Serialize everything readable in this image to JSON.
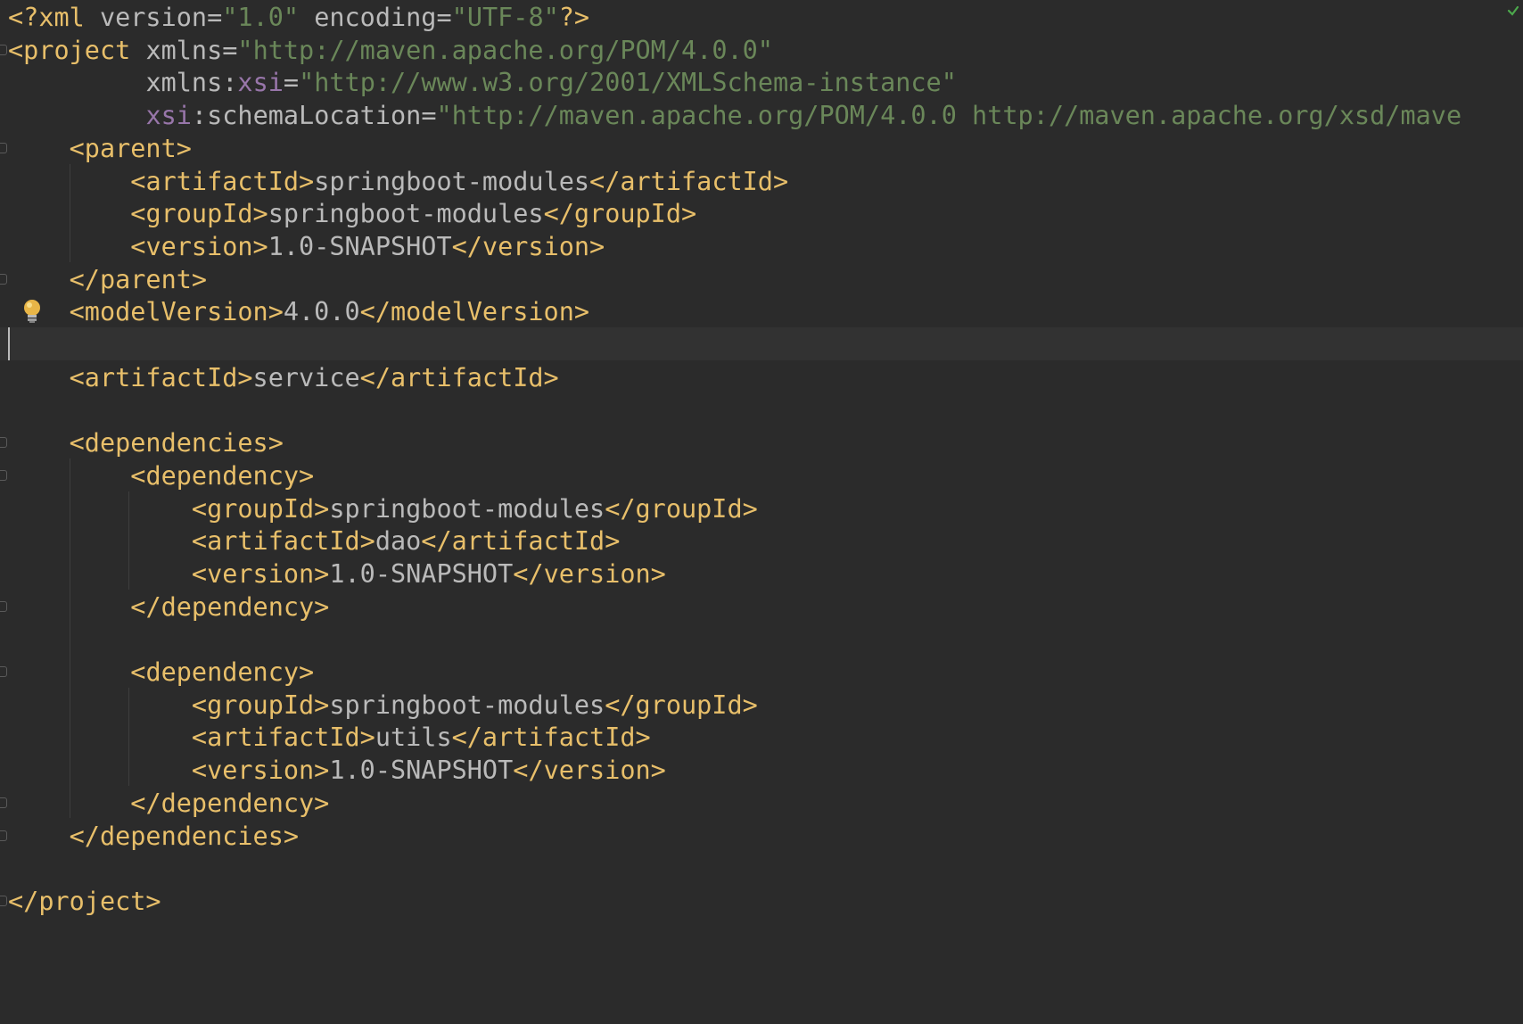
{
  "editor": {
    "language": "xml",
    "colors": {
      "background": "#2b2b2b",
      "tag": "#e8bf6a",
      "attribute": "#bababa",
      "namespace": "#9876aa",
      "string": "#6a8759",
      "text": "#bababa"
    },
    "lines": [
      {
        "indent": "",
        "tokens": [
          {
            "t": "tag",
            "s": "<?xml "
          },
          {
            "t": "attr",
            "s": "version"
          },
          {
            "t": "punc",
            "s": "="
          },
          {
            "t": "val",
            "s": "\"1.0\""
          },
          {
            "t": "punc",
            "s": " "
          },
          {
            "t": "attr",
            "s": "encoding"
          },
          {
            "t": "punc",
            "s": "="
          },
          {
            "t": "val",
            "s": "\"UTF-8\""
          },
          {
            "t": "tag",
            "s": "?>"
          }
        ]
      },
      {
        "indent": "",
        "tokens": [
          {
            "t": "tag",
            "s": "<project "
          },
          {
            "t": "attr",
            "s": "xmlns"
          },
          {
            "t": "punc",
            "s": "="
          },
          {
            "t": "val",
            "s": "\"http://maven.apache.org/POM/4.0.0\""
          }
        ]
      },
      {
        "indent": "         ",
        "tokens": [
          {
            "t": "attr",
            "s": "xmlns"
          },
          {
            "t": "punc",
            "s": ":"
          },
          {
            "t": "ns",
            "s": "xsi"
          },
          {
            "t": "punc",
            "s": "="
          },
          {
            "t": "val",
            "s": "\"http://www.w3.org/2001/XMLSchema-instance\""
          }
        ]
      },
      {
        "indent": "         ",
        "tokens": [
          {
            "t": "ns",
            "s": "xsi"
          },
          {
            "t": "punc",
            "s": ":"
          },
          {
            "t": "attr",
            "s": "schemaLocation"
          },
          {
            "t": "punc",
            "s": "="
          },
          {
            "t": "val",
            "s": "\"http://maven.apache.org/POM/4.0.0 http://maven.apache.org/xsd/mave"
          }
        ]
      },
      {
        "indent": "    ",
        "tokens": [
          {
            "t": "tag",
            "s": "<parent>"
          }
        ]
      },
      {
        "indent": "        ",
        "tokens": [
          {
            "t": "tag",
            "s": "<artifactId>"
          },
          {
            "t": "text",
            "s": "springboot-modules"
          },
          {
            "t": "tag",
            "s": "</artifactId>"
          }
        ]
      },
      {
        "indent": "        ",
        "tokens": [
          {
            "t": "tag",
            "s": "<groupId>"
          },
          {
            "t": "text",
            "s": "springboot-modules"
          },
          {
            "t": "tag",
            "s": "</groupId>"
          }
        ]
      },
      {
        "indent": "        ",
        "tokens": [
          {
            "t": "tag",
            "s": "<version>"
          },
          {
            "t": "text",
            "s": "1.0-SNAPSHOT"
          },
          {
            "t": "tag",
            "s": "</version>"
          }
        ]
      },
      {
        "indent": "    ",
        "tokens": [
          {
            "t": "tag",
            "s": "</parent>"
          }
        ]
      },
      {
        "indent": "    ",
        "tokens": [
          {
            "t": "tag",
            "s": "<modelVersion>"
          },
          {
            "t": "text",
            "s": "4.0.0"
          },
          {
            "t": "tag",
            "s": "</modelVersion>"
          }
        ]
      },
      {
        "indent": "",
        "tokens": []
      },
      {
        "indent": "    ",
        "tokens": [
          {
            "t": "tag",
            "s": "<artifactId>"
          },
          {
            "t": "text",
            "s": "service"
          },
          {
            "t": "tag",
            "s": "</artifactId>"
          }
        ]
      },
      {
        "indent": "",
        "tokens": []
      },
      {
        "indent": "    ",
        "tokens": [
          {
            "t": "tag",
            "s": "<dependencies>"
          }
        ]
      },
      {
        "indent": "        ",
        "tokens": [
          {
            "t": "tag",
            "s": "<dependency>"
          }
        ]
      },
      {
        "indent": "            ",
        "tokens": [
          {
            "t": "tag",
            "s": "<groupId>"
          },
          {
            "t": "text",
            "s": "springboot-modules"
          },
          {
            "t": "tag",
            "s": "</groupId>"
          }
        ]
      },
      {
        "indent": "            ",
        "tokens": [
          {
            "t": "tag",
            "s": "<artifactId>"
          },
          {
            "t": "text",
            "s": "dao"
          },
          {
            "t": "tag",
            "s": "</artifactId>"
          }
        ]
      },
      {
        "indent": "            ",
        "tokens": [
          {
            "t": "tag",
            "s": "<version>"
          },
          {
            "t": "text",
            "s": "1.0-SNAPSHOT"
          },
          {
            "t": "tag",
            "s": "</version>"
          }
        ]
      },
      {
        "indent": "        ",
        "tokens": [
          {
            "t": "tag",
            "s": "</dependency>"
          }
        ]
      },
      {
        "indent": "",
        "tokens": []
      },
      {
        "indent": "        ",
        "tokens": [
          {
            "t": "tag",
            "s": "<dependency>"
          }
        ]
      },
      {
        "indent": "            ",
        "tokens": [
          {
            "t": "tag",
            "s": "<groupId>"
          },
          {
            "t": "text",
            "s": "springboot-modules"
          },
          {
            "t": "tag",
            "s": "</groupId>"
          }
        ]
      },
      {
        "indent": "            ",
        "tokens": [
          {
            "t": "tag",
            "s": "<artifactId>"
          },
          {
            "t": "text",
            "s": "utils"
          },
          {
            "t": "tag",
            "s": "</artifactId>"
          }
        ]
      },
      {
        "indent": "            ",
        "tokens": [
          {
            "t": "tag",
            "s": "<version>"
          },
          {
            "t": "text",
            "s": "1.0-SNAPSHOT"
          },
          {
            "t": "tag",
            "s": "</version>"
          }
        ]
      },
      {
        "indent": "        ",
        "tokens": [
          {
            "t": "tag",
            "s": "</dependency>"
          }
        ]
      },
      {
        "indent": "    ",
        "tokens": [
          {
            "t": "tag",
            "s": "</dependencies>"
          }
        ]
      },
      {
        "indent": "",
        "tokens": []
      },
      {
        "indent": "",
        "tokens": [
          {
            "t": "tag",
            "s": "</project>"
          }
        ]
      }
    ],
    "caret_line": 11,
    "intention_bulb_line": 10,
    "folded_lines": [
      2,
      5,
      9,
      14,
      15,
      19,
      21,
      25,
      26,
      28
    ],
    "icons": [
      "intention-bulb-icon",
      "inspection-ok-icon"
    ]
  }
}
